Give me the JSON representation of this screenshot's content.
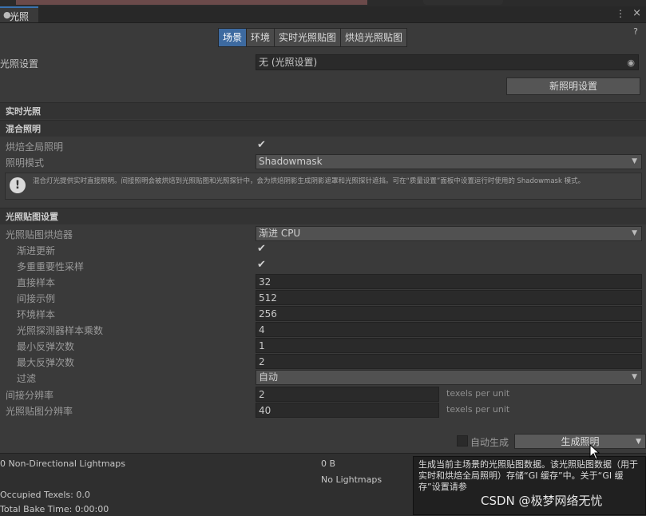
{
  "window": {
    "title": "光照",
    "help_icon": "?",
    "menu_icon": "⋮",
    "close_icon": "×"
  },
  "tabs": [
    {
      "label": "场景",
      "active": true
    },
    {
      "label": "环境",
      "active": false
    },
    {
      "label": "实时光照贴图",
      "active": false
    },
    {
      "label": "烘焙光照贴图",
      "active": false
    }
  ],
  "lighting_settings": {
    "label": "光照设置",
    "value": "无 (光照设置)",
    "new_button": "新照明设置"
  },
  "sections": {
    "realtime": "实时光照",
    "mixed": "混合照明",
    "lightmapping": "光照贴图设置"
  },
  "mixed": {
    "baked_gi_label": "烘焙全局照明",
    "baked_gi_checked": true,
    "lighting_mode_label": "照明模式",
    "lighting_mode_value": "Shadowmask",
    "help_text": "混合灯光提供实时直接照明。间接照明会被烘焙到光照贴图和光照探针中，会为烘焙阴影生成阴影遮罩和光照探针遮挡。可在“质量设置”面板中设置运行时使用的 Shadowmask 模式。"
  },
  "lightmapper": {
    "label": "光照贴图烘焙器",
    "value": "渐进 CPU",
    "progressive_updates_label": "渐进更新",
    "progressive_updates_checked": true,
    "mis_label": "多重重要性采样",
    "mis_checked": true,
    "direct_samples_label": "直接样本",
    "direct_samples": "32",
    "indirect_samples_label": "间接示例",
    "indirect_samples": "512",
    "env_samples_label": "环境样本",
    "env_samples": "256",
    "probe_multiplier_label": "光照探测器样本乘数",
    "probe_multiplier": "4",
    "min_bounces_label": "最小反弹次数",
    "min_bounces": "1",
    "max_bounces_label": "最大反弹次数",
    "max_bounces": "2",
    "filter_label": "过滤",
    "filter_value": "自动",
    "indirect_resolution_label": "间接分辨率",
    "indirect_resolution": "2",
    "indirect_resolution_unit": "texels per unit",
    "lightmap_resolution_label": "光照贴图分辨率",
    "lightmap_resolution": "40",
    "lightmap_resolution_unit": "texels per unit"
  },
  "generate": {
    "auto_label": "自动生成",
    "auto_checked": false,
    "button_label": "生成照明"
  },
  "bottom": {
    "lightmaps_summary": "0 Non-Directional Lightmaps",
    "size": "0 B",
    "no_lightmaps": "No Lightmaps",
    "occupied_texels": "Occupied Texels: 0.0",
    "total_bake_time": "Total Bake Time: 0:00:00"
  },
  "tooltip": {
    "text": "生成当前主场景的光照贴图数据。该光照贴图数据（用于实时和烘焙全局照明）存储“GI 缓存”中。关于“GI 缓存”设置请参"
  },
  "watermark": "CSDN @极梦网络无忧"
}
